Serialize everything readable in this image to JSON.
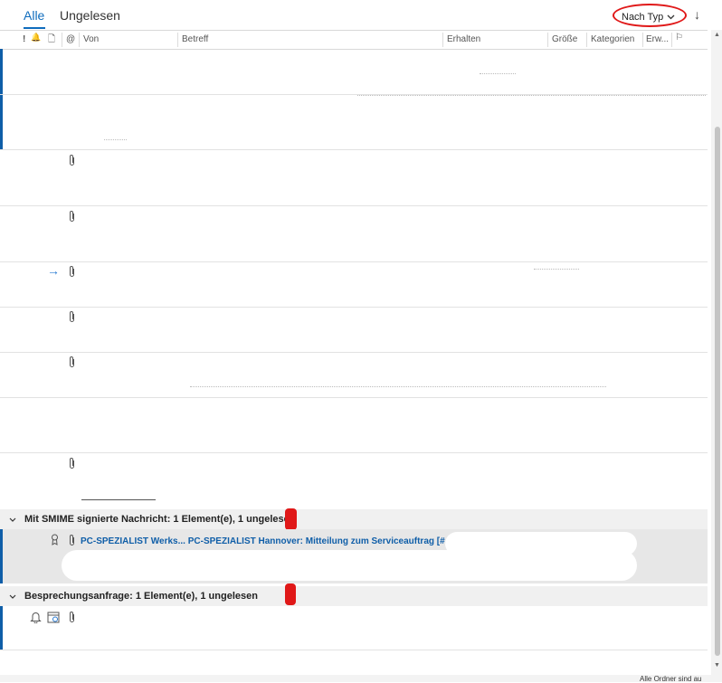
{
  "filter": {
    "all_label": "Alle",
    "unread_label": "Ungelesen",
    "sort_label": "Nach Typ",
    "sort_direction_glyph": "↓"
  },
  "columns": {
    "importance": "!",
    "reminder": "🔔",
    "type": "🗋",
    "attachment": "@",
    "from": "Von",
    "subject": "Betreff",
    "received": "Erhalten",
    "size": "Größe",
    "categories": "Kategorien",
    "extended": "Erw...",
    "flag": "⚐"
  },
  "groups": [
    {
      "title": "Mit SMIME signierte Nachricht: 1 Element(e), 1 ungelesen"
    },
    {
      "title": "Besprechungsanfrage: 1 Element(e), 1 ungelesen"
    }
  ],
  "smime_message": {
    "text": "PC-SPEZIALIST Werks... PC-SPEZIALIST Hannover: Mitteilung zum Serviceauftrag [#..."
  },
  "footer": {
    "text": "Alle Ordner sind au"
  },
  "colors": {
    "accent": "#0f6cbd",
    "annotation": "#e01818"
  }
}
